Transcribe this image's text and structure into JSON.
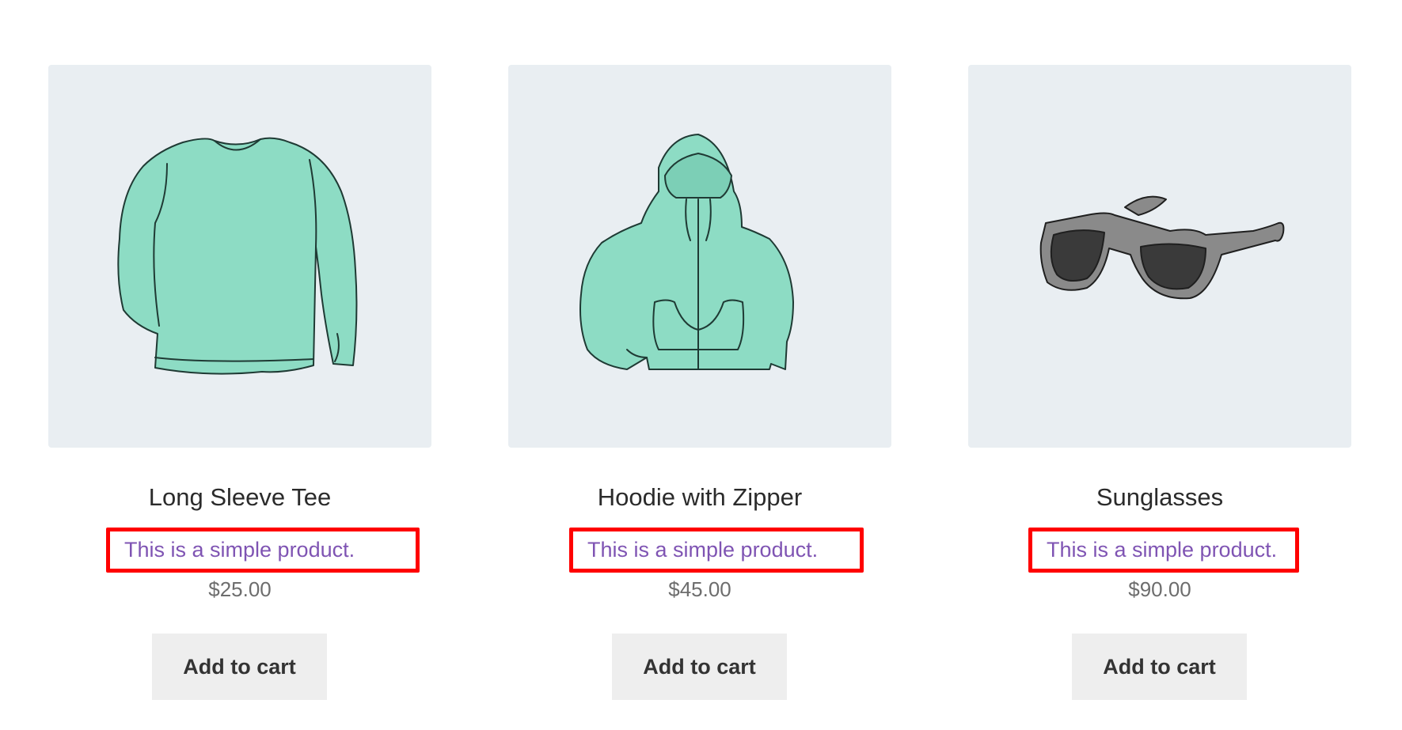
{
  "colors": {
    "image_bg": "#e9eef2",
    "title": "#2b2b2b",
    "description": "#7f54b3",
    "highlight_border": "#ff0000",
    "price": "#6d6d6d",
    "button_bg": "#eeeeee",
    "button_text": "#333333",
    "garment_fill": "#8ddcc4",
    "lens_fill": "#3a3a3a",
    "frame_fill": "#8a8a8a"
  },
  "products": [
    {
      "icon": "long-sleeve-tee-icon",
      "title": "Long Sleeve Tee",
      "description": "This is a simple product.",
      "price": "$25.00",
      "button_label": "Add to cart"
    },
    {
      "icon": "hoodie-with-zipper-icon",
      "title": "Hoodie with Zipper",
      "description": "This is a simple product.",
      "price": "$45.00",
      "button_label": "Add to cart"
    },
    {
      "icon": "sunglasses-icon",
      "title": "Sunglasses",
      "description": "This is a simple product.",
      "price": "$90.00",
      "button_label": "Add to cart"
    }
  ]
}
